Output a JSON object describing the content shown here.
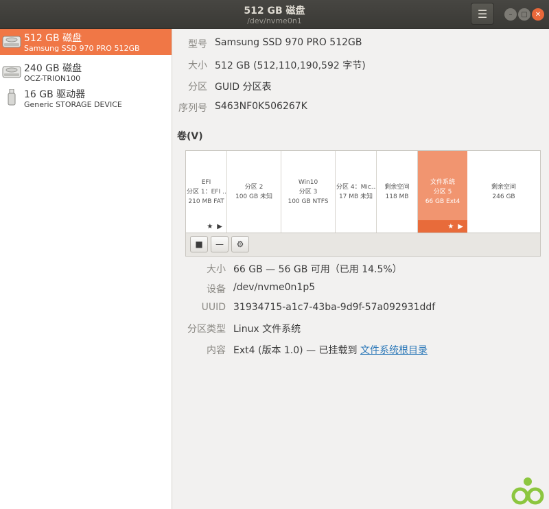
{
  "window": {
    "title": "512 GB 磁盘",
    "subtitle": "/dev/nvme0n1"
  },
  "drives": [
    {
      "name": "512 GB 磁盘",
      "sub": "Samsung SSD 970 PRO 512GB",
      "icon": "hdd-icon",
      "selected": true
    },
    {
      "name": "240 GB 磁盘",
      "sub": "OCZ-TRION100",
      "icon": "hdd-icon",
      "selected": false
    },
    {
      "name": "16 GB 驱动器",
      "sub": "Generic STORAGE DEVICE",
      "icon": "usb-drive-icon",
      "selected": false
    }
  ],
  "disk_info": [
    {
      "label": "型号",
      "value": "Samsung SSD 970 PRO 512GB"
    },
    {
      "label": "大小",
      "value": "512 GB (512,110,190,592 字节)"
    },
    {
      "label": "分区",
      "value": "GUID 分区表"
    },
    {
      "label": "序列号",
      "value": "S463NF0K506267K"
    }
  ],
  "volumes_heading": "卷(V)",
  "partitions": [
    {
      "lines": [
        "EFI",
        "分区 1：EFI …",
        "210 MB FAT"
      ],
      "star": "★",
      "arrow": "▶"
    },
    {
      "lines": [
        "分区 2",
        "100 GB 未知"
      ]
    },
    {
      "lines": [
        "Win10",
        "分区 3",
        "100 GB NTFS"
      ]
    },
    {
      "lines": [
        "分区 4：Mic…",
        "17 MB 未知"
      ]
    },
    {
      "lines": [
        "剩余空间",
        "118 MB"
      ]
    },
    {
      "lines": [
        "文件系统",
        "分区 5",
        "66 GB Ext4"
      ],
      "star": "★",
      "arrow": "▶",
      "selected": true
    },
    {
      "lines": [
        "剩余空间",
        "246 GB"
      ]
    }
  ],
  "toolbar": {
    "stop_icon": "■",
    "remove_icon": "—",
    "settings_icon": "⚙"
  },
  "details": [
    {
      "label": "大小",
      "value": "66 GB — 56 GB 可用（已用 14.5%）"
    },
    {
      "label": "设备",
      "value": "/dev/nvme0n1p5"
    },
    {
      "label": "UUID",
      "value": "31934715-a1c7-43ba-9d9f-57a092931ddf"
    },
    {
      "label": "分区类型",
      "value": "Linux 文件系统"
    },
    {
      "label": "内容",
      "value": "Ext4 (版本 1.0) — 已挂载到 ",
      "link": "文件系统根目录"
    }
  ],
  "colors": {
    "accent": "#f07746",
    "selected_partition": "#f19570",
    "title_bar": "#3c3b37",
    "link": "#2a77b8"
  }
}
